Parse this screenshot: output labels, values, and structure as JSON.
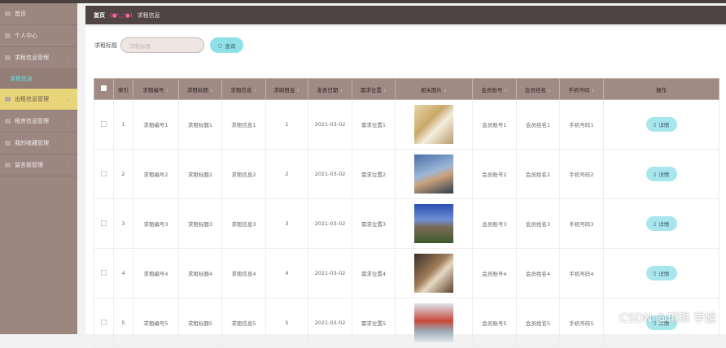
{
  "sidebar": {
    "items": [
      {
        "label": "首页",
        "icon": "home-icon"
      },
      {
        "label": "个人中心",
        "icon": "user-icon"
      },
      {
        "label": "求租信息管理",
        "icon": "list-icon"
      },
      {
        "label": "求租信息",
        "sub": true
      },
      {
        "label": "出租信息管理",
        "icon": "settings-icon",
        "active": true
      },
      {
        "label": "租房信息管理",
        "icon": "list-icon"
      },
      {
        "label": "我的收藏管理",
        "icon": "star-icon"
      },
      {
        "label": "留言板管理",
        "icon": "message-icon"
      }
    ]
  },
  "breadcrumb": {
    "home": "首页",
    "emoticon": "(●'◡'●)",
    "current": "求租信息"
  },
  "search": {
    "label": "求租标题",
    "placeholder": "求租标题",
    "button": "查询"
  },
  "table": {
    "headers": [
      "索引",
      "求租编号",
      "求租标题",
      "求租信息",
      "求助租金",
      "发表日期",
      "需求位置",
      "相关图片",
      "会员账号",
      "会员姓名",
      "手机号码",
      "操作"
    ],
    "action_label": "详情",
    "rows": [
      {
        "index": "1",
        "code": "求租编号1",
        "title": "求租标题1",
        "info": "求租信息1",
        "rent": "1",
        "date": "2021-03-02",
        "location": "需求位置1",
        "account": "会员账号1",
        "name": "会员姓名1",
        "phone": "手机号码1"
      },
      {
        "index": "2",
        "code": "求租编号2",
        "title": "求租标题2",
        "info": "求租信息2",
        "rent": "2",
        "date": "2021-03-02",
        "location": "需求位置2",
        "account": "会员账号2",
        "name": "会员姓名2",
        "phone": "手机号码2"
      },
      {
        "index": "3",
        "code": "求租编号3",
        "title": "求租标题3",
        "info": "求租信息3",
        "rent": "3",
        "date": "2021-03-02",
        "location": "需求位置3",
        "account": "会员账号3",
        "name": "会员姓名3",
        "phone": "手机号码3"
      },
      {
        "index": "4",
        "code": "求租编号4",
        "title": "求租标题4",
        "info": "求租信息4",
        "rent": "4",
        "date": "2021-03-02",
        "location": "需求位置4",
        "account": "会员账号4",
        "name": "会员姓名4",
        "phone": "手机号码4"
      },
      {
        "index": "5",
        "code": "求租编号5",
        "title": "求租标题5",
        "info": "求租信息5",
        "rent": "5",
        "date": "2021-03-02",
        "location": "需求位置5",
        "account": "会员账号5",
        "name": "会员姓名5",
        "phone": "手机号码5"
      }
    ]
  },
  "watermark": "CSDN @琪琪 学姐"
}
